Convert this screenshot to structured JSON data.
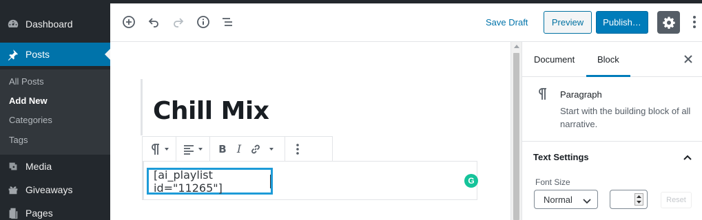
{
  "admin_menu": {
    "items": [
      {
        "label": "Dashboard",
        "icon": "dashboard-icon"
      },
      {
        "label": "Posts",
        "icon": "pushpin-icon"
      },
      {
        "label": "Media",
        "icon": "media-icon"
      },
      {
        "label": "Giveaways",
        "icon": "gift-icon"
      },
      {
        "label": "Pages",
        "icon": "pages-icon"
      }
    ],
    "posts_submenu": [
      "All Posts",
      "Add New",
      "Categories",
      "Tags"
    ]
  },
  "header": {
    "save_draft": "Save Draft",
    "preview": "Preview",
    "publish": "Publish…"
  },
  "editor": {
    "post_title": "Chill Mix",
    "shortcode": "[ai_playlist id=\"11265\"]"
  },
  "panel": {
    "tab_document": "Document",
    "tab_block": "Block",
    "block_name": "Paragraph",
    "block_description": "Start with the building block of all narrative.",
    "text_settings_heading": "Text Settings",
    "font_size_label": "Font Size",
    "font_size_value": "Normal",
    "reset_label": "Reset"
  },
  "colors": {
    "admin_bg": "#23282d",
    "accent": "#0073aa",
    "publish": "#007cba",
    "highlight_border": "#1d9bd8",
    "grammarly": "#15c39a"
  }
}
